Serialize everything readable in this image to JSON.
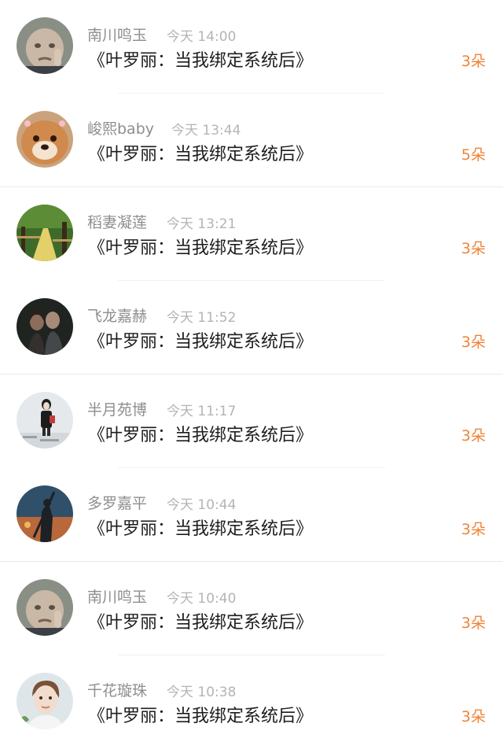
{
  "comments": [
    {
      "user": "南川鸣玉",
      "time": "今天 14:00",
      "text": "《叶罗丽：当我绑定系统后》",
      "gift": "3朵",
      "avatar": "baby-face-avatar"
    },
    {
      "user": "峻熙baby",
      "time": "今天 13:44",
      "text": "《叶罗丽：当我绑定系统后》",
      "gift": "5朵",
      "avatar": "shiba-dog-avatar"
    },
    {
      "user": "稻妻凝莲",
      "time": "今天 13:21",
      "text": "《叶罗丽：当我绑定系统后》",
      "gift": "3朵",
      "avatar": "forest-path-avatar"
    },
    {
      "user": "飞龙嘉赫",
      "time": "今天 11:52",
      "text": "《叶罗丽：当我绑定系统后》",
      "gift": "3朵",
      "avatar": "couple-photo-avatar"
    },
    {
      "user": "半月苑博",
      "time": "今天 11:17",
      "text": "《叶罗丽：当我绑定系统后》",
      "gift": "3朵",
      "avatar": "girl-portrait-avatar"
    },
    {
      "user": "多罗嘉平",
      "time": "今天 10:44",
      "text": "《叶罗丽：当我绑定系统后》",
      "gift": "3朵",
      "avatar": "warrior-silhouette-avatar"
    },
    {
      "user": "南川鸣玉",
      "time": "今天 10:40",
      "text": "《叶罗丽：当我绑定系统后》",
      "gift": "3朵",
      "avatar": "baby-face-avatar"
    },
    {
      "user": "千花璇珠",
      "time": "今天 10:38",
      "text": "《叶罗丽：当我绑定系统后》",
      "gift": "3朵",
      "avatar": "young-man-avatar"
    }
  ],
  "colors": {
    "gift_count": "#f08437",
    "username": "#8e8e8e",
    "timestamp": "#b4b4b4",
    "title": "#1d1d1d"
  }
}
